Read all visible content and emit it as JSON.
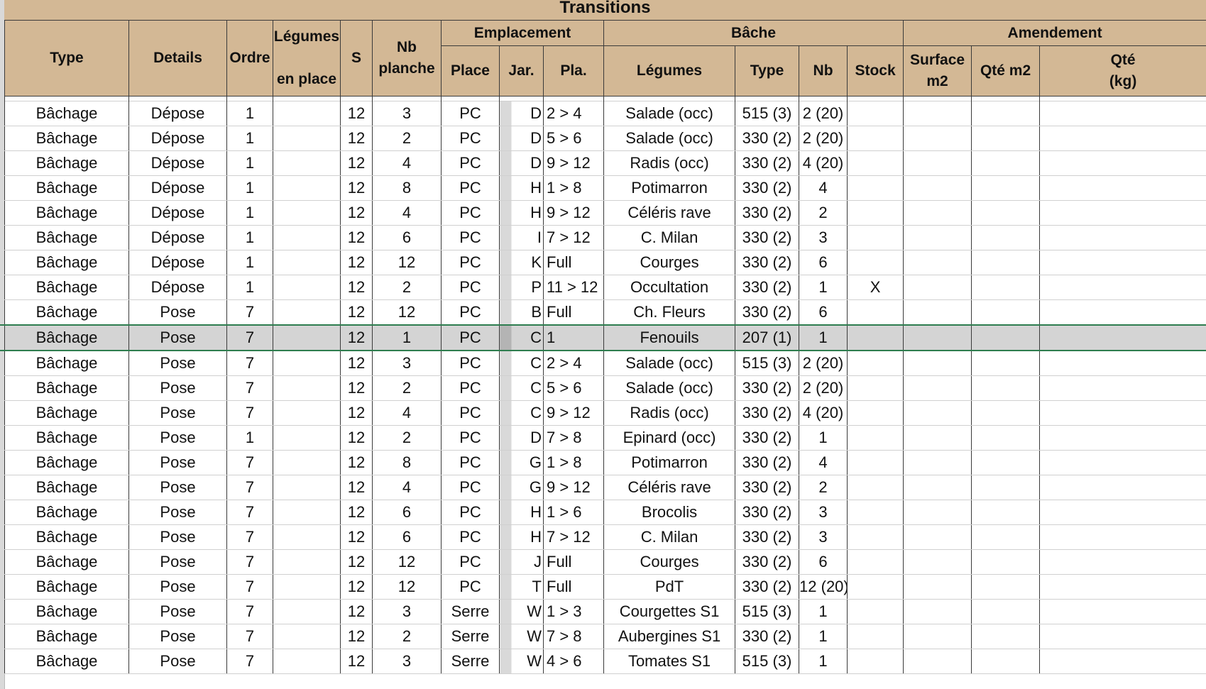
{
  "sheet": {
    "title": "Transitions"
  },
  "headers": {
    "type": "Type",
    "details": "Details",
    "ordre": "Ordre",
    "legumes_en_place_1": "Légumes",
    "legumes_en_place_2": "en place",
    "s": "S",
    "nb_planche_1": "Nb",
    "nb_planche_2": "planche",
    "emplacement": "Emplacement",
    "place": "Place",
    "jar": "Jar.",
    "pla": "Pla.",
    "bache": "Bâche",
    "bache_legumes": "Légumes",
    "bache_type": "Type",
    "bache_nb": "Nb",
    "bache_stock": "Stock",
    "amendement": "Amendement",
    "surface_1": "Surface",
    "surface_2": "m2",
    "qte_m2": "Qté m2",
    "qte_kg_1": "Qté",
    "qte_kg_2": "(kg)"
  },
  "rows": [
    {
      "type": "Bâchage",
      "details": "Dépose",
      "ordre": "1",
      "legumes_en_place": "",
      "s": "12",
      "nb_planche": "3",
      "place": "PC",
      "jar": "D",
      "pla": "2 > 4",
      "legumes": "Salade (occ)",
      "bache_type": "515 (3)",
      "nb": "2 (20)",
      "stock": "",
      "surface": "",
      "qte_m2": "",
      "qte_kg": ""
    },
    {
      "type": "Bâchage",
      "details": "Dépose",
      "ordre": "1",
      "legumes_en_place": "",
      "s": "12",
      "nb_planche": "2",
      "place": "PC",
      "jar": "D",
      "pla": "5 > 6",
      "legumes": "Salade (occ)",
      "bache_type": "330 (2)",
      "nb": "2 (20)",
      "stock": "",
      "surface": "",
      "qte_m2": "",
      "qte_kg": ""
    },
    {
      "type": "Bâchage",
      "details": "Dépose",
      "ordre": "1",
      "legumes_en_place": "",
      "s": "12",
      "nb_planche": "4",
      "place": "PC",
      "jar": "D",
      "pla": "9 > 12",
      "legumes": "Radis (occ)",
      "bache_type": "330 (2)",
      "nb": "4 (20)",
      "stock": "",
      "surface": "",
      "qte_m2": "",
      "qte_kg": ""
    },
    {
      "type": "Bâchage",
      "details": "Dépose",
      "ordre": "1",
      "legumes_en_place": "",
      "s": "12",
      "nb_planche": "8",
      "place": "PC",
      "jar": "H",
      "pla": "1 > 8",
      "legumes": "Potimarron",
      "bache_type": "330 (2)",
      "nb": "4",
      "stock": "",
      "surface": "",
      "qte_m2": "",
      "qte_kg": ""
    },
    {
      "type": "Bâchage",
      "details": "Dépose",
      "ordre": "1",
      "legumes_en_place": "",
      "s": "12",
      "nb_planche": "4",
      "place": "PC",
      "jar": "H",
      "pla": "9 > 12",
      "legumes": "Céléris rave",
      "bache_type": "330 (2)",
      "nb": "2",
      "stock": "",
      "surface": "",
      "qte_m2": "",
      "qte_kg": ""
    },
    {
      "type": "Bâchage",
      "details": "Dépose",
      "ordre": "1",
      "legumes_en_place": "",
      "s": "12",
      "nb_planche": "6",
      "place": "PC",
      "jar": "I",
      "pla": "7 > 12",
      "legumes": "C. Milan",
      "bache_type": "330 (2)",
      "nb": "3",
      "stock": "",
      "surface": "",
      "qte_m2": "",
      "qte_kg": ""
    },
    {
      "type": "Bâchage",
      "details": "Dépose",
      "ordre": "1",
      "legumes_en_place": "",
      "s": "12",
      "nb_planche": "12",
      "place": "PC",
      "jar": "K",
      "pla": "Full",
      "legumes": "Courges",
      "bache_type": "330 (2)",
      "nb": "6",
      "stock": "",
      "surface": "",
      "qte_m2": "",
      "qte_kg": ""
    },
    {
      "type": "Bâchage",
      "details": "Dépose",
      "ordre": "1",
      "legumes_en_place": "",
      "s": "12",
      "nb_planche": "2",
      "place": "PC",
      "jar": "P",
      "pla": "11 > 12",
      "legumes": "Occultation",
      "bache_type": "330 (2)",
      "nb": "1",
      "stock": "X",
      "surface": "",
      "qte_m2": "",
      "qte_kg": ""
    },
    {
      "type": "Bâchage",
      "details": "Pose",
      "ordre": "7",
      "legumes_en_place": "",
      "s": "12",
      "nb_planche": "12",
      "place": "PC",
      "jar": "B",
      "pla": "Full",
      "legumes": "Ch. Fleurs",
      "bache_type": "330 (2)",
      "nb": "6",
      "stock": "",
      "surface": "",
      "qte_m2": "",
      "qte_kg": ""
    },
    {
      "type": "Bâchage",
      "details": "Pose",
      "ordre": "7",
      "legumes_en_place": "",
      "s": "12",
      "nb_planche": "1",
      "place": "PC",
      "jar": "C",
      "pla": "1",
      "legumes": "Fenouils",
      "bache_type": "207 (1)",
      "nb": "1",
      "stock": "",
      "surface": "",
      "qte_m2": "",
      "qte_kg": ""
    },
    {
      "type": "Bâchage",
      "details": "Pose",
      "ordre": "7",
      "legumes_en_place": "",
      "s": "12",
      "nb_planche": "3",
      "place": "PC",
      "jar": "C",
      "pla": "2 > 4",
      "legumes": "Salade (occ)",
      "bache_type": "515 (3)",
      "nb": "2 (20)",
      "stock": "",
      "surface": "",
      "qte_m2": "",
      "qte_kg": ""
    },
    {
      "type": "Bâchage",
      "details": "Pose",
      "ordre": "7",
      "legumes_en_place": "",
      "s": "12",
      "nb_planche": "2",
      "place": "PC",
      "jar": "C",
      "pla": "5 > 6",
      "legumes": "Salade (occ)",
      "bache_type": "330 (2)",
      "nb": "2 (20)",
      "stock": "",
      "surface": "",
      "qte_m2": "",
      "qte_kg": ""
    },
    {
      "type": "Bâchage",
      "details": "Pose",
      "ordre": "7",
      "legumes_en_place": "",
      "s": "12",
      "nb_planche": "4",
      "place": "PC",
      "jar": "C",
      "pla": "9 > 12",
      "legumes": "Radis (occ)",
      "bache_type": "330 (2)",
      "nb": "4 (20)",
      "stock": "",
      "surface": "",
      "qte_m2": "",
      "qte_kg": ""
    },
    {
      "type": "Bâchage",
      "details": "Pose",
      "ordre": "1",
      "legumes_en_place": "",
      "s": "12",
      "nb_planche": "2",
      "place": "PC",
      "jar": "D",
      "pla": "7 > 8",
      "legumes": "Epinard (occ)",
      "bache_type": "330 (2)",
      "nb": "1",
      "stock": "",
      "surface": "",
      "qte_m2": "",
      "qte_kg": ""
    },
    {
      "type": "Bâchage",
      "details": "Pose",
      "ordre": "7",
      "legumes_en_place": "",
      "s": "12",
      "nb_planche": "8",
      "place": "PC",
      "jar": "G",
      "pla": "1 > 8",
      "legumes": "Potimarron",
      "bache_type": "330 (2)",
      "nb": "4",
      "stock": "",
      "surface": "",
      "qte_m2": "",
      "qte_kg": ""
    },
    {
      "type": "Bâchage",
      "details": "Pose",
      "ordre": "7",
      "legumes_en_place": "",
      "s": "12",
      "nb_planche": "4",
      "place": "PC",
      "jar": "G",
      "pla": "9 > 12",
      "legumes": "Céléris rave",
      "bache_type": "330 (2)",
      "nb": "2",
      "stock": "",
      "surface": "",
      "qte_m2": "",
      "qte_kg": ""
    },
    {
      "type": "Bâchage",
      "details": "Pose",
      "ordre": "7",
      "legumes_en_place": "",
      "s": "12",
      "nb_planche": "6",
      "place": "PC",
      "jar": "H",
      "pla": "1 > 6",
      "legumes": "Brocolis",
      "bache_type": "330 (2)",
      "nb": "3",
      "stock": "",
      "surface": "",
      "qte_m2": "",
      "qte_kg": ""
    },
    {
      "type": "Bâchage",
      "details": "Pose",
      "ordre": "7",
      "legumes_en_place": "",
      "s": "12",
      "nb_planche": "6",
      "place": "PC",
      "jar": "H",
      "pla": "7 > 12",
      "legumes": "C. Milan",
      "bache_type": "330 (2)",
      "nb": "3",
      "stock": "",
      "surface": "",
      "qte_m2": "",
      "qte_kg": ""
    },
    {
      "type": "Bâchage",
      "details": "Pose",
      "ordre": "7",
      "legumes_en_place": "",
      "s": "12",
      "nb_planche": "12",
      "place": "PC",
      "jar": "J",
      "pla": "Full",
      "legumes": "Courges",
      "bache_type": "330 (2)",
      "nb": "6",
      "stock": "",
      "surface": "",
      "qte_m2": "",
      "qte_kg": ""
    },
    {
      "type": "Bâchage",
      "details": "Pose",
      "ordre": "7",
      "legumes_en_place": "",
      "s": "12",
      "nb_planche": "12",
      "place": "PC",
      "jar": "T",
      "pla": "Full",
      "legumes": "PdT",
      "bache_type": "330 (2)",
      "nb": "12 (20)",
      "stock": "",
      "surface": "",
      "qte_m2": "",
      "qte_kg": ""
    },
    {
      "type": "Bâchage",
      "details": "Pose",
      "ordre": "7",
      "legumes_en_place": "",
      "s": "12",
      "nb_planche": "3",
      "place": "Serre",
      "jar": "W",
      "pla": "1 > 3",
      "legumes": "Courgettes S1",
      "bache_type": "515 (3)",
      "nb": "1",
      "stock": "",
      "surface": "",
      "qte_m2": "",
      "qte_kg": ""
    },
    {
      "type": "Bâchage",
      "details": "Pose",
      "ordre": "7",
      "legumes_en_place": "",
      "s": "12",
      "nb_planche": "2",
      "place": "Serre",
      "jar": "W",
      "pla": "7 > 8",
      "legumes": "Aubergines S1",
      "bache_type": "330 (2)",
      "nb": "1",
      "stock": "",
      "surface": "",
      "qte_m2": "",
      "qte_kg": ""
    },
    {
      "type": "Bâchage",
      "details": "Pose",
      "ordre": "7",
      "legumes_en_place": "",
      "s": "12",
      "nb_planche": "3",
      "place": "Serre",
      "jar": "W",
      "pla": "4 > 6",
      "legumes": "Tomates S1",
      "bache_type": "515 (3)",
      "nb": "1",
      "stock": "",
      "surface": "",
      "qte_m2": "",
      "qte_kg": ""
    }
  ],
  "selected_row": 9,
  "colors": {
    "header_bg": "#d3b895",
    "selection_border": "#2e7d4f",
    "selection_bg": "#d4d4d4",
    "gridline": "#d0d0d0"
  }
}
